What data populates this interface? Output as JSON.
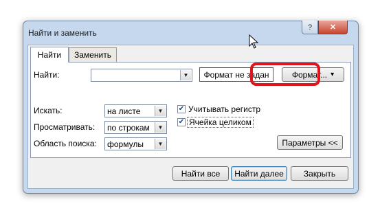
{
  "window": {
    "title": "Найти и заменить",
    "help_glyph": "?",
    "close_glyph": "✕"
  },
  "tabs": [
    {
      "label": "Найти",
      "active": true
    },
    {
      "label": "Заменить",
      "active": false
    }
  ],
  "find": {
    "label": "Найти:",
    "value": "",
    "format_preview": "Формат не задан",
    "format_button": "Формат...",
    "format_button_arrow": "▾"
  },
  "options": {
    "search": {
      "label": "Искать:",
      "value": "на листе"
    },
    "look_by": {
      "label": "Просматривать:",
      "value": "по строкам"
    },
    "look_in": {
      "label": "Область поиска:",
      "value": "формулы"
    },
    "match_case": {
      "label": "Учитывать регистр",
      "checked": true
    },
    "entire_cell": {
      "label": "Ячейка целиком",
      "checked": true
    },
    "params_button": "Параметры <<"
  },
  "buttons": {
    "find_all": "Найти все",
    "find_next": "Найти далее",
    "close": "Закрыть"
  },
  "combo_arrow": "▼",
  "check_mark": "✔",
  "colors": {
    "highlight": "#e0141a",
    "window_frame": "#c5d8ee"
  }
}
